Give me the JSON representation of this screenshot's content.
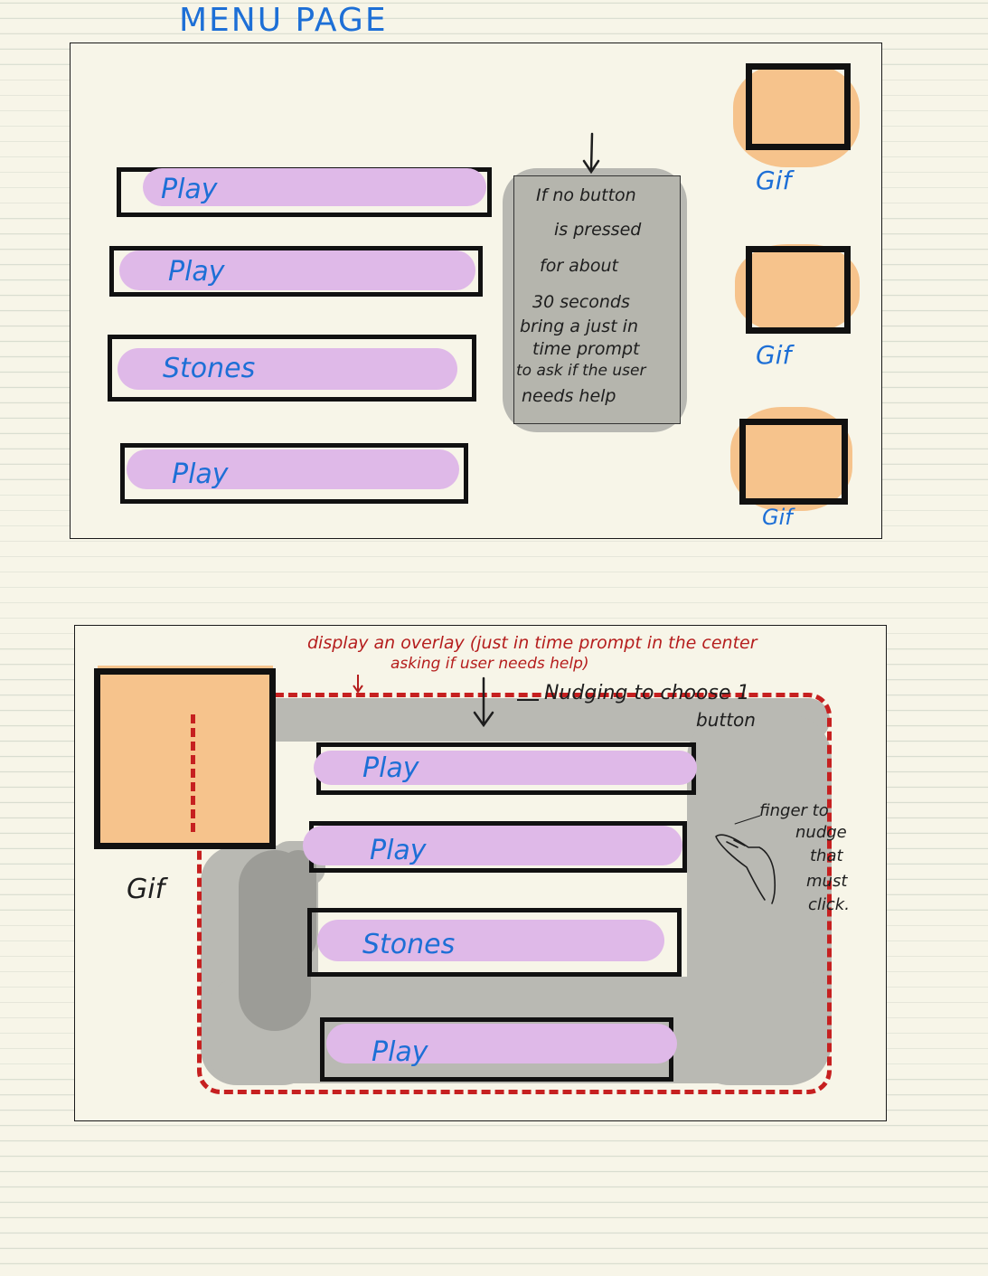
{
  "page_title": "MENU PAGE",
  "menu_screen": {
    "buttons": [
      {
        "label": "Play"
      },
      {
        "label": "Play"
      },
      {
        "label": "Stones"
      },
      {
        "label": "Play"
      }
    ],
    "gifs": [
      {
        "label": "Gif"
      },
      {
        "label": "Gif"
      },
      {
        "label": "Gif"
      }
    ],
    "note_lines": [
      "If no button",
      "is pressed",
      "for about",
      "30 seconds",
      "bring a just in",
      "time prompt",
      "to ask if the user",
      "needs help"
    ]
  },
  "overlay_screen": {
    "annotation_line1": "display an overlay (just in time prompt in the center",
    "annotation_line2": "asking if user needs help)",
    "nudging_line1": "Nudging to choose 1",
    "nudging_line2": "button",
    "finger_note": [
      "finger to",
      "nudge",
      "that",
      "must",
      "click."
    ],
    "buttons": [
      {
        "label": "Play"
      },
      {
        "label": "Play"
      },
      {
        "label": "Stones"
      },
      {
        "label": "Play"
      }
    ],
    "gif_label": "Gif"
  },
  "colors": {
    "button_fill": "#dfb9e8",
    "gif_fill": "#f6c38c",
    "ink_blue": "#1d6fd6",
    "ink_red": "#c62020",
    "overlay_grey": "#b9b9b3"
  }
}
